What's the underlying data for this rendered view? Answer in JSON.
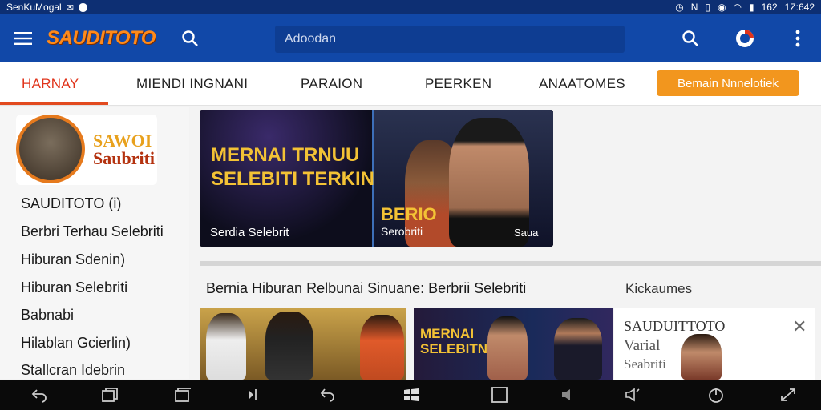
{
  "status_bar": {
    "left_text": "SenKuMogal",
    "time": "1Z:642",
    "battery": "162"
  },
  "app": {
    "brand": "SAUDITOTO",
    "search_placeholder": "Adoodan"
  },
  "tabs": [
    {
      "label": "HARNAY",
      "active": true
    },
    {
      "label": "MIENDI INGNANI",
      "active": false
    },
    {
      "label": "PARAION",
      "active": false
    },
    {
      "label": "PEERKEN",
      "active": false
    },
    {
      "label": "ANAATOMES",
      "active": false
    }
  ],
  "cta_label": "Bemain Nnnelotiek",
  "sidebar": {
    "logo_text_1": "SAWOI",
    "logo_text_2": "Saubriti",
    "items": [
      "SAUDITOTO (i)",
      "Berbri Terhau Selebriti",
      "Hiburan  Sdenin)",
      "Hiburan Selebriti",
      "Babnabi",
      "Hilablan  Gcierlin)",
      "Stallcran  Idebrin"
    ]
  },
  "banner": {
    "headline_1": "MERNAI TRNUU",
    "headline_2": "SELEBITI TERKIN",
    "caption_left": "Serdia Selebrit",
    "name": "BERIO",
    "caption_mid": "Serobriti",
    "caption_right": "Saua"
  },
  "section": {
    "title": "Bernia  Hiburan Relbunai Sinuane: Berbrii Selebriti",
    "side_label": "Kickaumes"
  },
  "thumb2": {
    "title_1": "MERNAI",
    "title_2": "SELEBITNI"
  },
  "ad": {
    "title": "SAUDUITTOTO",
    "sub1": "Varial",
    "sub2": "Seabriti",
    "close": "✕"
  },
  "colors": {
    "appbar": "#1148a8",
    "statusbar": "#0d2f73",
    "accent": "#e0331a",
    "cta": "#f2961e",
    "brand": "#ff8a1a"
  }
}
